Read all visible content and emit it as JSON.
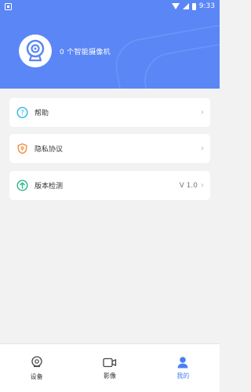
{
  "status_bar": {
    "time": "9:33"
  },
  "profile": {
    "device_count_label": "0 个智能摄像机"
  },
  "menu": [
    {
      "label": "帮助",
      "value": "",
      "icon": "help-icon",
      "icon_color": "#29b6e8"
    },
    {
      "label": "隐私协议",
      "value": "",
      "icon": "privacy-shield-icon",
      "icon_color": "#f08c3a"
    },
    {
      "label": "版本检测",
      "value": "V 1.0",
      "icon": "upload-arrow-icon",
      "icon_color": "#2bb58a"
    }
  ],
  "bottom_nav": [
    {
      "label": "设备",
      "icon": "camera-device-icon",
      "active": false
    },
    {
      "label": "影像",
      "icon": "video-icon",
      "active": false
    },
    {
      "label": "我的",
      "icon": "user-icon",
      "active": true
    }
  ],
  "colors": {
    "header_bg": "#5a86f6",
    "active_tab": "#4a7ef5"
  }
}
